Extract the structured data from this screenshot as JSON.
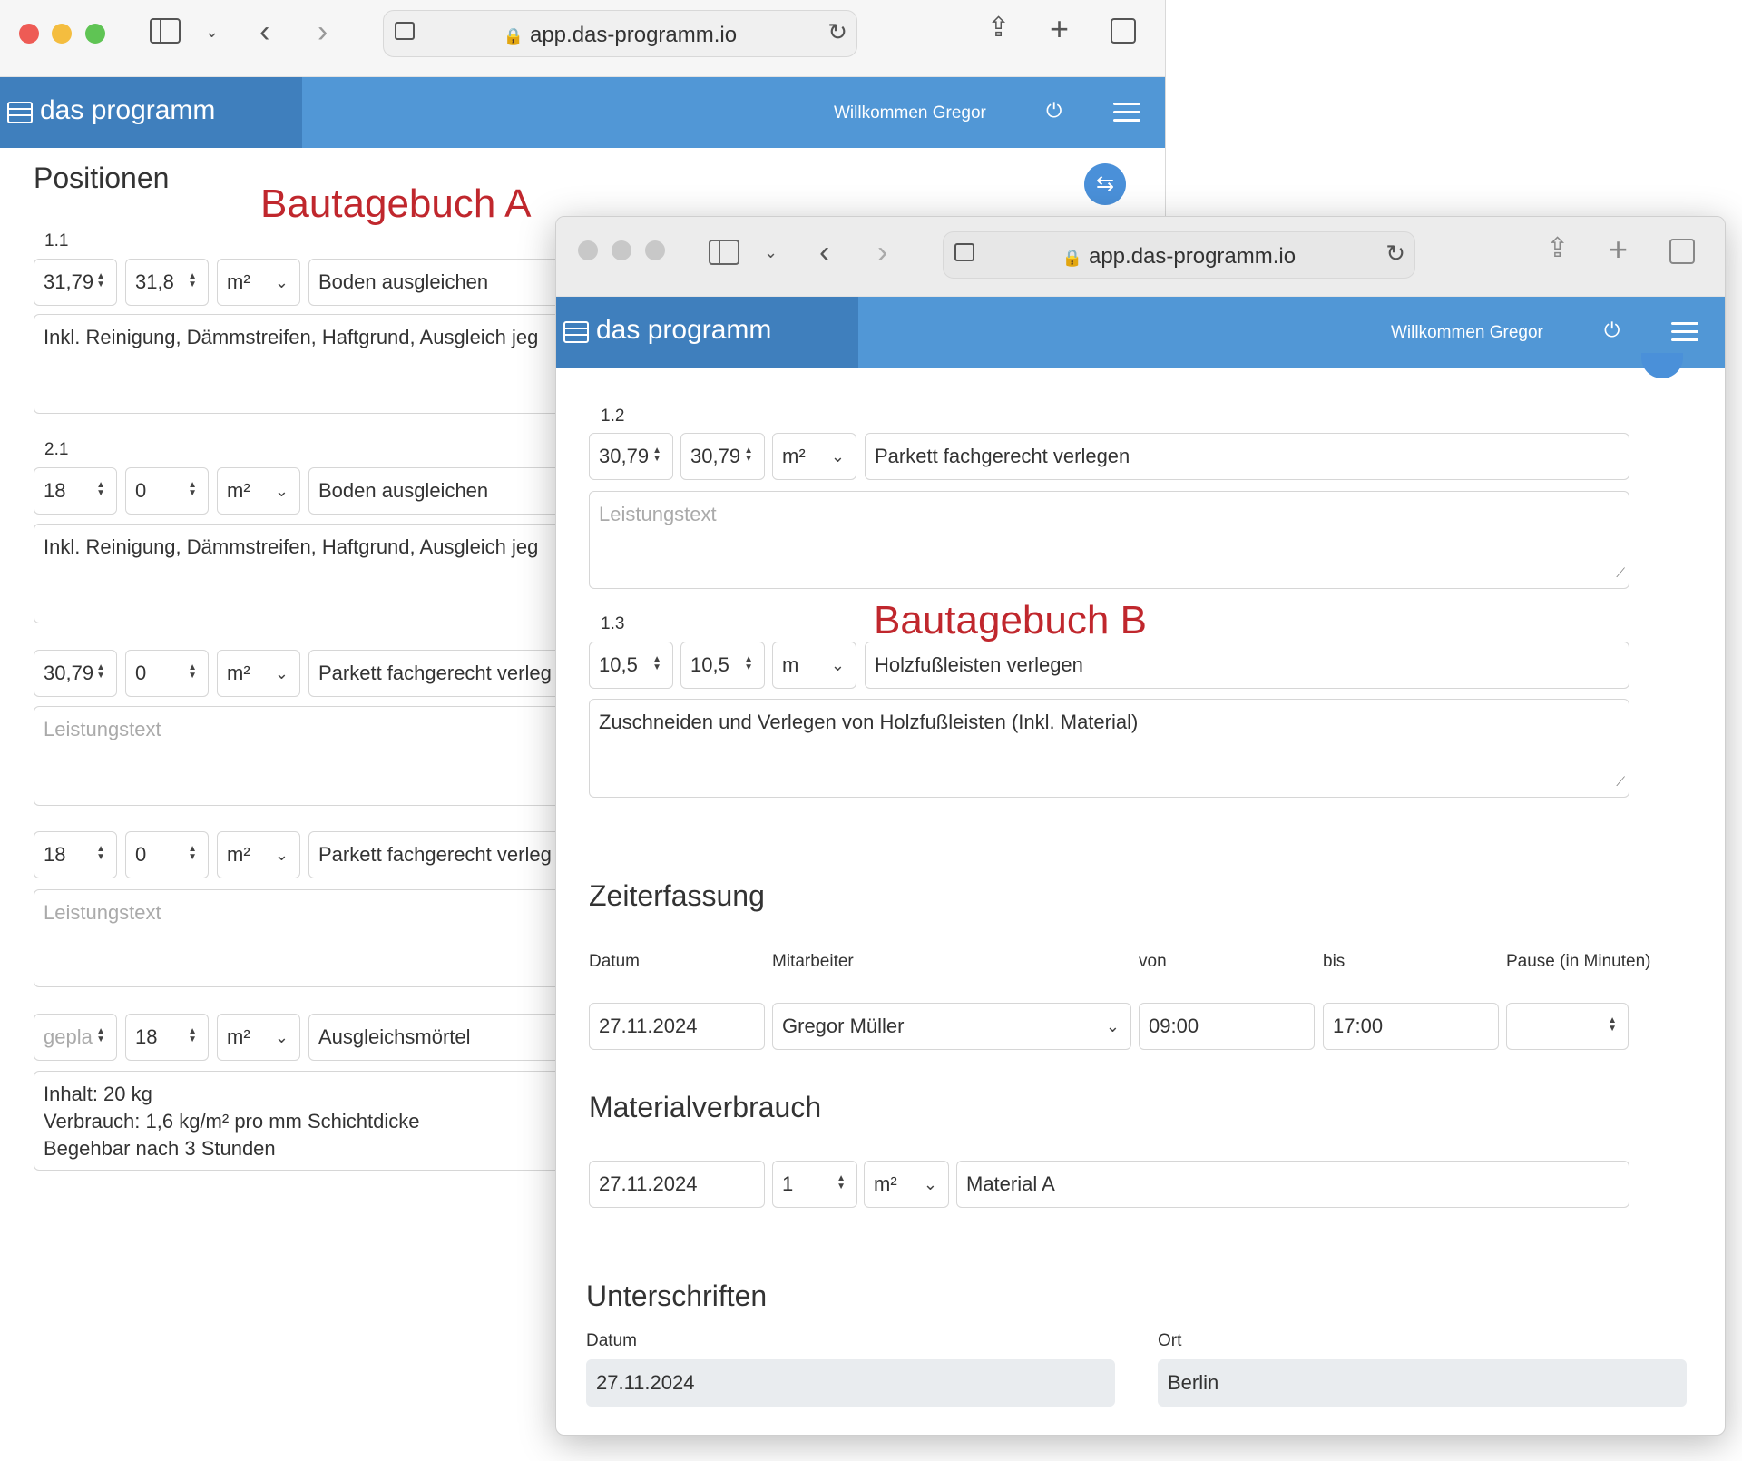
{
  "browser": {
    "url": "app.das-programm.io"
  },
  "app": {
    "brand": "das programm",
    "welcome": "Willkommen Gregor"
  },
  "winA": {
    "heading": "Positionen",
    "annotation": "Bautagebuch A",
    "pos1": {
      "label": "1.1",
      "qty1": "31,79",
      "qty2": "31,8",
      "unit": "m²",
      "title": "Boden ausgleichen",
      "text": "Inkl. Reinigung, Dämmstreifen, Haftgrund, Ausgleich jeg"
    },
    "pos2": {
      "label": "2.1",
      "qty1": "18",
      "qty2": "0",
      "unit": "m²",
      "title": "Boden ausgleichen",
      "text": "Inkl. Reinigung, Dämmstreifen, Haftgrund, Ausgleich jeg"
    },
    "pos3": {
      "qty1": "30,79",
      "qty2": "0",
      "unit": "m²",
      "title": "Parkett fachgerecht verleg",
      "placeholder": "Leistungstext"
    },
    "pos4": {
      "qty1": "18",
      "qty2": "0",
      "unit": "m²",
      "title": "Parkett fachgerecht verleg",
      "placeholder": "Leistungstext"
    },
    "pos5": {
      "qty1_placeholder": "gepla",
      "qty2": "18",
      "unit": "m²",
      "title": "Ausgleichsmörtel",
      "lines": [
        "Inhalt: 20 kg",
        "Verbrauch: 1,6 kg/m² pro mm Schichtdicke",
        "Begehbar nach 3 Stunden"
      ]
    }
  },
  "winB": {
    "annotation": "Bautagebuch B",
    "pos1": {
      "label": "1.2",
      "qty1": "30,79",
      "qty2": "30,79",
      "unit": "m²",
      "title": "Parkett fachgerecht verlegen",
      "placeholder": "Leistungstext"
    },
    "pos2": {
      "label": "1.3",
      "qty1": "10,5",
      "qty2": "10,5",
      "unit": "m",
      "title": "Holzfußleisten verlegen",
      "text": "Zuschneiden und Verlegen von Holzfußleisten (Inkl. Material)"
    },
    "zeit": {
      "heading": "Zeiterfassung",
      "col_datum": "Datum",
      "col_mitarbeiter": "Mitarbeiter",
      "col_von": "von",
      "col_bis": "bis",
      "col_pause": "Pause (in Minuten)",
      "datum": "27.11.2024",
      "mitarbeiter": "Gregor Müller",
      "von": "09:00",
      "bis": "17:00"
    },
    "material": {
      "heading": "Materialverbrauch",
      "datum": "27.11.2024",
      "menge": "1",
      "unit": "m²",
      "name": "Material A"
    },
    "sign": {
      "heading": "Unterschriften",
      "col_datum": "Datum",
      "col_ort": "Ort",
      "datum": "27.11.2024",
      "ort": "Berlin"
    }
  }
}
